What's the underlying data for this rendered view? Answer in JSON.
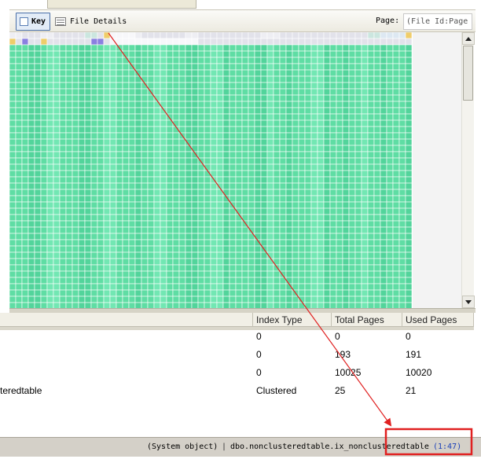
{
  "toolbar": {
    "key_label": "Key",
    "file_details_label": "File Details",
    "page_label": "Page:",
    "page_placeholder": "(File Id:Page"
  },
  "page_map": {
    "columns": 64,
    "rows": 44,
    "colors": {
      "empty": "#E2E2EA",
      "empty_light": "#EEEEF3",
      "white": "#F7F7FA",
      "aqua_grey": "#CBE6DF",
      "light_blue": "#DDE8F2",
      "yellow": "#EFCD6A",
      "purple": "#8A7FE0",
      "green_0": "#72E7B3",
      "green_1": "#5FDDA4",
      "green_2": "#52D49B",
      "grid_line": "#FFFFFF"
    },
    "green_band_pattern": "1112210011122110011121100111221100211112201121110021121101121112",
    "row_overrides": {
      "0": {
        "default": "empty",
        "cells": {
          "0": "empty_light",
          "1": "empty_light",
          "5": "empty_light",
          "6": "empty_light",
          "12": "aqua_grey",
          "13": "aqua_grey",
          "15": "yellow",
          "16": "white",
          "17": "white",
          "18": "white",
          "19": "white",
          "20": "empty_light",
          "28": "empty_light",
          "29": "empty_light",
          "40": "empty_light",
          "41": "empty_light",
          "42": "empty_light",
          "57": "aqua_grey",
          "58": "aqua_grey",
          "59": "light_blue",
          "60": "light_blue",
          "61": "light_blue",
          "62": "light_blue",
          "63": "yellow"
        }
      },
      "1": {
        "default": "empty",
        "cells": {
          "0": "yellow",
          "2": "purple",
          "5": "yellow",
          "13": "purple",
          "14": "purple",
          "16": "white",
          "17": "white",
          "18": "white",
          "19": "white",
          "20": "white",
          "21": "white",
          "22": "white",
          "23": "white",
          "24": "white",
          "25": "white",
          "26": "white",
          "27": "white",
          "28": "white",
          "29": "white"
        }
      }
    }
  },
  "table": {
    "headers": [
      "",
      "Index Type",
      "Total Pages",
      "Used Pages"
    ],
    "rows": [
      {
        "cells": [
          "",
          "0",
          "0",
          "0"
        ]
      },
      {
        "cells": [
          "",
          "0",
          "193",
          "191"
        ]
      },
      {
        "cells": [
          "",
          "0",
          "10025",
          "10020"
        ]
      },
      {
        "cells": [
          "teredtable",
          "Clustered",
          "25",
          "21"
        ]
      }
    ]
  },
  "status": {
    "object_type": "(System object)",
    "separator": "|",
    "object_name": "dbo.nonclusteredtable.ix_nonclusteredtable",
    "page_id": "(1:47)",
    "page_id_color": "#1A3FB8"
  },
  "annotation": {
    "color": "#E02020"
  }
}
